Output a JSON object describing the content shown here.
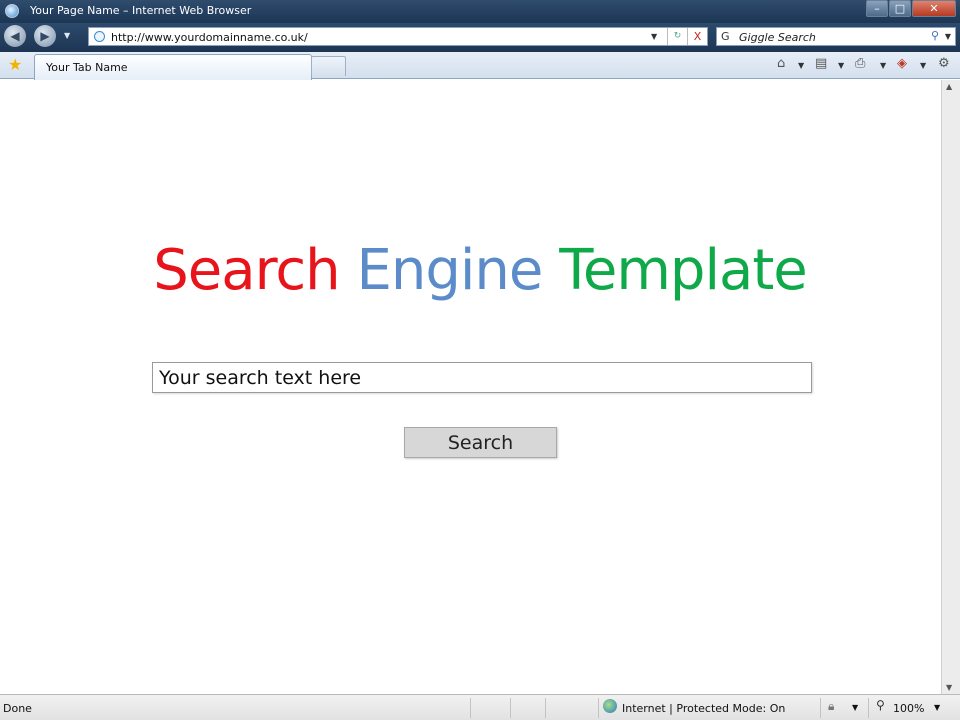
{
  "window": {
    "title": "Your Page Name – Internet Web Browser",
    "minimize_glyph": "–",
    "maximize_glyph": "□",
    "close_glyph": "✕"
  },
  "nav": {
    "back_glyph": "◀",
    "forward_glyph": "▶",
    "address": "http://www.yourdomainname.co.uk/",
    "refresh_glyph": "↻",
    "stop_glyph": "X",
    "search_placeholder": "Giggle Search"
  },
  "tabs": [
    {
      "label": "Your Tab Name"
    }
  ],
  "page": {
    "heading_words": [
      "Search",
      "Engine",
      "Template"
    ],
    "search_text": "Your search text here",
    "search_button": "Search"
  },
  "status": {
    "text": "Done",
    "zone": "Internet | Protected Mode: On",
    "zoom": "100%"
  },
  "colors": {
    "heading_word_1": "#e8141b",
    "heading_word_2": "#5b8cc9",
    "heading_word_3": "#10a94a",
    "titlebar": "#1c3654"
  },
  "icons": [
    "browser-logo-icon",
    "back-icon",
    "forward-icon",
    "page-icon",
    "refresh-icon",
    "stop-icon",
    "search-provider-icon",
    "search-go-icon",
    "favorites-star-icon",
    "home-icon",
    "feeds-icon",
    "print-icon",
    "safety-icon",
    "tools-gear-icon",
    "globe-icon",
    "lock-icon",
    "zoom-icon"
  ]
}
